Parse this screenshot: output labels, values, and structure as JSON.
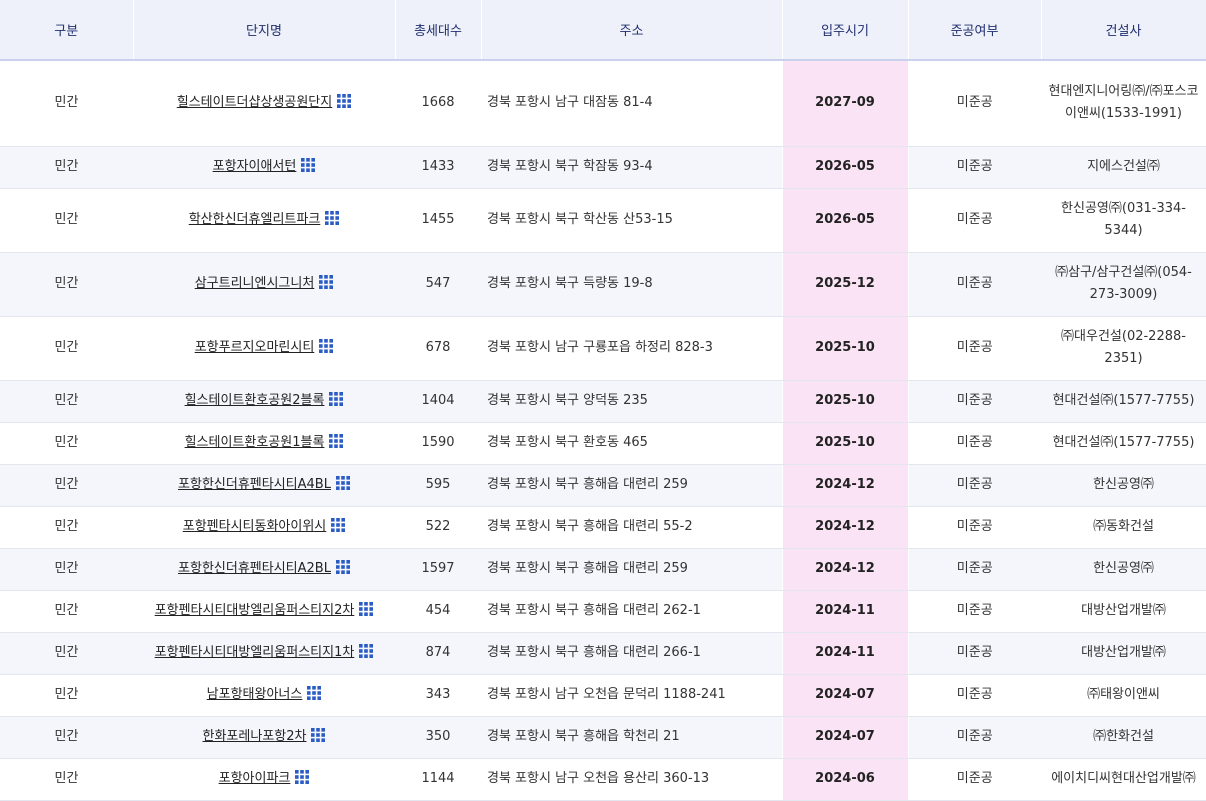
{
  "header": {
    "type": "구분",
    "name": "단지명",
    "units": "총세대수",
    "address": "주소",
    "move_in": "입주시기",
    "completion": "준공여부",
    "builder": "건설사"
  },
  "icon": "grid-icon",
  "colors": {
    "header_bg": "#eef1fa",
    "header_text": "#1f2d6e",
    "date_bg": "#f9e3f5",
    "icon": "#2a5cc4"
  },
  "rows": [
    {
      "type": "민간",
      "name": "힐스테이트더샵상생공원단지",
      "units": "1668",
      "address": "경북 포항시 남구 대잠동 81-4",
      "move_in": "2027-09",
      "completion": "미준공",
      "builder": "현대엔지니어링㈜/㈜포스코이앤씨(1533-1991)"
    },
    {
      "type": "민간",
      "name": "포항자이애서턴",
      "units": "1433",
      "address": "경북 포항시 북구 학잠동 93-4",
      "move_in": "2026-05",
      "completion": "미준공",
      "builder": "지에스건설㈜"
    },
    {
      "type": "민간",
      "name": "학산한신더휴엘리트파크",
      "units": "1455",
      "address": "경북 포항시 북구 학산동 산53-15",
      "move_in": "2026-05",
      "completion": "미준공",
      "builder": "한신공영㈜(031-334-5344)"
    },
    {
      "type": "민간",
      "name": "삼구트리니엔시그니처",
      "units": "547",
      "address": "경북 포항시 북구 득량동 19-8",
      "move_in": "2025-12",
      "completion": "미준공",
      "builder": "㈜삼구/삼구건설㈜(054-273-3009)"
    },
    {
      "type": "민간",
      "name": "포항푸르지오마린시티",
      "units": "678",
      "address": "경북 포항시 남구 구룡포읍 하정리 828-3",
      "move_in": "2025-10",
      "completion": "미준공",
      "builder": "㈜대우건설(02-2288-2351)"
    },
    {
      "type": "민간",
      "name": "힐스테이트환호공원2블록",
      "units": "1404",
      "address": "경북 포항시 북구 양덕동 235",
      "move_in": "2025-10",
      "completion": "미준공",
      "builder": "현대건설㈜(1577-7755)"
    },
    {
      "type": "민간",
      "name": "힐스테이트환호공원1블록",
      "units": "1590",
      "address": "경북 포항시 북구 환호동 465",
      "move_in": "2025-10",
      "completion": "미준공",
      "builder": "현대건설㈜(1577-7755)"
    },
    {
      "type": "민간",
      "name": "포항한신더휴펜타시티A4BL",
      "units": "595",
      "address": "경북 포항시 북구 흥해읍 대련리 259",
      "move_in": "2024-12",
      "completion": "미준공",
      "builder": "한신공영㈜"
    },
    {
      "type": "민간",
      "name": "포항펜타시티동화아이위시",
      "units": "522",
      "address": "경북 포항시 북구 흥해읍 대련리 55-2",
      "move_in": "2024-12",
      "completion": "미준공",
      "builder": "㈜동화건설"
    },
    {
      "type": "민간",
      "name": "포항한신더휴펜타시티A2BL",
      "units": "1597",
      "address": "경북 포항시 북구 흥해읍 대련리 259",
      "move_in": "2024-12",
      "completion": "미준공",
      "builder": "한신공영㈜"
    },
    {
      "type": "민간",
      "name": "포항펜타시티대방엘리움퍼스티지2차",
      "units": "454",
      "address": "경북 포항시 북구 흥해읍 대련리 262-1",
      "move_in": "2024-11",
      "completion": "미준공",
      "builder": "대방산업개발㈜"
    },
    {
      "type": "민간",
      "name": "포항펜타시티대방엘리움퍼스티지1차",
      "units": "874",
      "address": "경북 포항시 북구 흥해읍 대련리 266-1",
      "move_in": "2024-11",
      "completion": "미준공",
      "builder": "대방산업개발㈜"
    },
    {
      "type": "민간",
      "name": "남포항태왕아너스",
      "units": "343",
      "address": "경북 포항시 남구 오천읍 문덕리 1188-241",
      "move_in": "2024-07",
      "completion": "미준공",
      "builder": "㈜태왕이앤씨"
    },
    {
      "type": "민간",
      "name": "한화포레나포항2차",
      "units": "350",
      "address": "경북 포항시 북구 흥해읍 학천리 21",
      "move_in": "2024-07",
      "completion": "미준공",
      "builder": "㈜한화건설"
    },
    {
      "type": "민간",
      "name": "포항아이파크",
      "units": "1144",
      "address": "경북 포항시 남구 오천읍 용산리 360-13",
      "move_in": "2024-06",
      "completion": "미준공",
      "builder": "에이치디씨현대산업개발㈜"
    }
  ]
}
